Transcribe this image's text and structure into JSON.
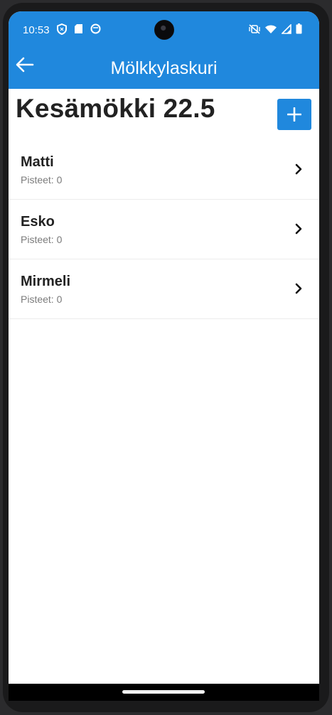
{
  "status_bar": {
    "time": "10:53",
    "left_icons": [
      "shield-icon",
      "sd-card-icon",
      "notification-icon"
    ],
    "right_icons": [
      "vibrate-off-icon",
      "wifi-icon",
      "signal-icon",
      "battery-icon"
    ]
  },
  "app_bar": {
    "back_icon": "arrow-left-icon",
    "title": "Mölkkylaskuri"
  },
  "page": {
    "title": "Kesämökki 22.5",
    "add_icon": "plus-icon"
  },
  "players": [
    {
      "name": "Matti",
      "score": "Pisteet: 0"
    },
    {
      "name": "Esko",
      "score": "Pisteet: 0"
    },
    {
      "name": "Mirmeli",
      "score": "Pisteet: 0"
    }
  ],
  "colors": {
    "primary": "#2088dd",
    "text": "#222222",
    "subtext": "#7b7b7b"
  }
}
